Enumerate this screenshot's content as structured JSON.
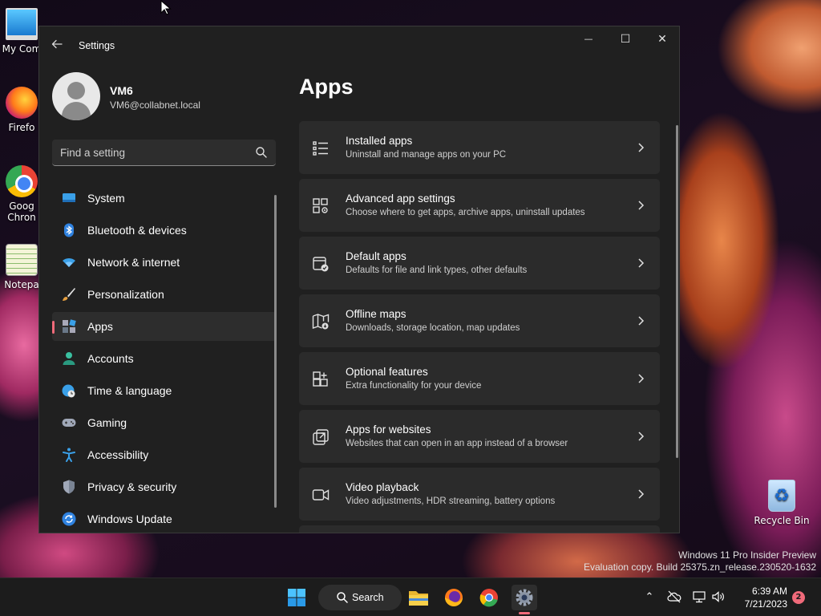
{
  "desktop": {
    "icons": [
      {
        "label": "My Com"
      },
      {
        "label": "Firefo"
      },
      {
        "label": "Goog\nChron"
      },
      {
        "label": "Notepa"
      },
      {
        "label": "Recycle Bin"
      }
    ],
    "watermark_line1": "Windows 11 Pro Insider Preview",
    "watermark_line2": "Evaluation copy. Build 25375.zn_release.230520-1632"
  },
  "window": {
    "title": "Settings",
    "controls": {
      "minimize": "—",
      "maximize": "☐",
      "close": "✕"
    }
  },
  "profile": {
    "name": "VM6",
    "email": "VM6@collabnet.local"
  },
  "search": {
    "placeholder": "Find a setting"
  },
  "nav": {
    "items": [
      {
        "label": "System",
        "icon": "system-icon"
      },
      {
        "label": "Bluetooth & devices",
        "icon": "bluetooth-icon"
      },
      {
        "label": "Network & internet",
        "icon": "wifi-icon"
      },
      {
        "label": "Personalization",
        "icon": "brush-icon"
      },
      {
        "label": "Apps",
        "icon": "apps-icon",
        "active": true
      },
      {
        "label": "Accounts",
        "icon": "person-icon"
      },
      {
        "label": "Time & language",
        "icon": "clock-globe-icon"
      },
      {
        "label": "Gaming",
        "icon": "gamepad-icon"
      },
      {
        "label": "Accessibility",
        "icon": "accessibility-icon"
      },
      {
        "label": "Privacy & security",
        "icon": "shield-icon"
      },
      {
        "label": "Windows Update",
        "icon": "update-icon"
      }
    ]
  },
  "main": {
    "title": "Apps",
    "cards": [
      {
        "title": "Installed apps",
        "desc": "Uninstall and manage apps on your PC",
        "icon": "list-icon"
      },
      {
        "title": "Advanced app settings",
        "desc": "Choose where to get apps, archive apps, uninstall updates",
        "icon": "apps-gear-icon"
      },
      {
        "title": "Default apps",
        "desc": "Defaults for file and link types, other defaults",
        "icon": "default-apps-icon"
      },
      {
        "title": "Offline maps",
        "desc": "Downloads, storage location, map updates",
        "icon": "map-icon"
      },
      {
        "title": "Optional features",
        "desc": "Extra functionality for your device",
        "icon": "add-grid-icon"
      },
      {
        "title": "Apps for websites",
        "desc": "Websites that can open in an app instead of a browser",
        "icon": "open-external-icon"
      },
      {
        "title": "Video playback",
        "desc": "Video adjustments, HDR streaming, battery options",
        "icon": "video-icon"
      }
    ]
  },
  "taskbar": {
    "search_label": "Search",
    "time": "6:39 AM",
    "date": "7/21/2023",
    "notification_count": "2"
  },
  "colors": {
    "accent": "#f06a7a",
    "window_bg": "#202020",
    "card_bg": "#2b2b2b",
    "taskbar_bg": "#1c1c1c"
  }
}
